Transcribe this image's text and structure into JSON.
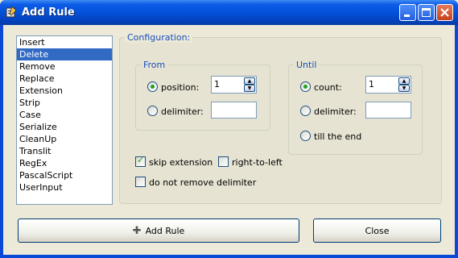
{
  "window": {
    "title": "Add Rule",
    "controls": [
      "minimize-icon",
      "maximize-icon",
      "close-icon"
    ]
  },
  "rules_list": {
    "items": [
      "Insert",
      "Delete",
      "Remove",
      "Replace",
      "Extension",
      "Strip",
      "Case",
      "Serialize",
      "CleanUp",
      "Translit",
      "RegEx",
      "PascalScript",
      "UserInput"
    ],
    "selected": "Delete"
  },
  "configuration": {
    "legend": "Configuration:",
    "from": {
      "legend": "From",
      "position_label": "position:",
      "position_value": "1",
      "delimiter_label": "delimiter:",
      "delimiter_value": "",
      "selected": "position"
    },
    "until": {
      "legend": "Until",
      "count_label": "count:",
      "count_value": "1",
      "delimiter_label": "delimiter:",
      "delimiter_value": "",
      "till_end_label": "till the end",
      "selected": "count"
    },
    "skip_extension_label": "skip extension",
    "skip_extension_checked": true,
    "right_to_left_label": "right-to-left",
    "right_to_left_checked": false,
    "do_not_remove_delimiter_label": "do not remove delimiter",
    "do_not_remove_delimiter_checked": false
  },
  "buttons": {
    "add_rule": "Add Rule",
    "close": "Close"
  },
  "colors": {
    "titlebar": "#0451d9",
    "selection": "#316ac5",
    "legend_text": "#1a4eb8",
    "check_green": "#21a121"
  }
}
